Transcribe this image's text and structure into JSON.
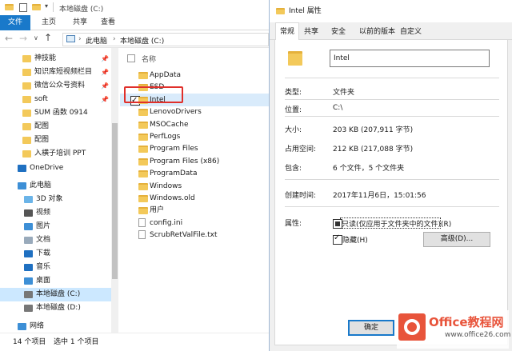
{
  "explorer": {
    "title": "本地磁盘 (C:)",
    "ribbon_tabs": [
      "文件",
      "主页",
      "共享",
      "查看"
    ],
    "breadcrumb": [
      "此电脑",
      "本地磁盘 (C:)"
    ],
    "nav": [
      {
        "label": "神技能",
        "icon": "folder-icon",
        "pinned": true
      },
      {
        "label": "知识库短视频栏目",
        "icon": "folder-icon",
        "pinned": true
      },
      {
        "label": "微信公众号资料",
        "icon": "folder-icon",
        "pinned": true
      },
      {
        "label": "soft",
        "icon": "folder-icon",
        "pinned": true
      },
      {
        "label": "SUM 函数 0914",
        "icon": "folder-icon",
        "pinned": false
      },
      {
        "label": "配图",
        "icon": "folder-icon",
        "pinned": false
      },
      {
        "label": "配图",
        "icon": "folder-icon",
        "pinned": false
      },
      {
        "label": "入横子培训 PPT",
        "icon": "folder-icon",
        "pinned": false
      },
      {
        "label": "OneDrive",
        "icon": "cloud-icon",
        "pinned": false
      },
      {
        "label": "此电脑",
        "icon": "computer-icon",
        "pinned": false
      },
      {
        "label": "3D 对象",
        "icon": "cube-icon",
        "pinned": false
      },
      {
        "label": "视频",
        "icon": "video-icon",
        "pinned": false
      },
      {
        "label": "图片",
        "icon": "picture-icon",
        "pinned": false
      },
      {
        "label": "文档",
        "icon": "document-icon",
        "pinned": false
      },
      {
        "label": "下载",
        "icon": "download-icon",
        "pinned": false
      },
      {
        "label": "音乐",
        "icon": "music-icon",
        "pinned": false
      },
      {
        "label": "桌面",
        "icon": "desktop-icon",
        "pinned": false
      },
      {
        "label": "本地磁盘 (C:)",
        "icon": "drive-icon",
        "pinned": false
      },
      {
        "label": "本地磁盘 (D:)",
        "icon": "drive-icon",
        "pinned": false
      },
      {
        "label": "网络",
        "icon": "network-icon",
        "pinned": false
      }
    ],
    "column_header": "名称",
    "files": [
      {
        "name": "AppData",
        "type": "folder"
      },
      {
        "name": "ESD",
        "type": "folder"
      },
      {
        "name": "Intel",
        "type": "folder"
      },
      {
        "name": "LenovoDrivers",
        "type": "folder"
      },
      {
        "name": "MSOCache",
        "type": "folder"
      },
      {
        "name": "PerfLogs",
        "type": "folder"
      },
      {
        "name": "Program Files",
        "type": "folder"
      },
      {
        "name": "Program Files (x86)",
        "type": "folder"
      },
      {
        "name": "ProgramData",
        "type": "folder"
      },
      {
        "name": "Windows",
        "type": "folder"
      },
      {
        "name": "Windows.old",
        "type": "folder"
      },
      {
        "name": "用户",
        "type": "folder"
      },
      {
        "name": "config.ini",
        "type": "file"
      },
      {
        "name": "ScrubRetValFile.txt",
        "type": "file"
      }
    ],
    "status": {
      "count": "14 个项目",
      "selected": "选中 1 个项目"
    }
  },
  "dialog": {
    "title": "Intel 属性",
    "tabs": [
      "常规",
      "共享",
      "安全",
      "以前的版本",
      "自定义"
    ],
    "name_value": "Intel",
    "rows": {
      "type_label": "类型:",
      "type_value": "文件夹",
      "location_label": "位置:",
      "location_value": "C:\\",
      "size_label": "大小:",
      "size_value": "203 KB (207,911 字节)",
      "disk_label": "占用空间:",
      "disk_value": "212 KB (217,088 字节)",
      "contains_label": "包含:",
      "contains_value": "6 个文件，5 个文件夹",
      "created_label": "创建时间:",
      "created_value": "2017年11月6日，15:01:56",
      "attributes_label": "属性:"
    },
    "readonly_label": "只读(仅应用于文件夹中的文件)(R)",
    "hidden_label": "隐藏(H)",
    "hidden_checked": true,
    "advanced_label": "高级(D)...",
    "ok_label": "确定"
  },
  "watermark": {
    "brand": "Office教程网",
    "url": "www.office26.com"
  },
  "colors": {
    "accent": "#1979ca",
    "selection": "#cce8ff",
    "highlight_box": "#e0302b",
    "folder": "#f3c95a"
  }
}
